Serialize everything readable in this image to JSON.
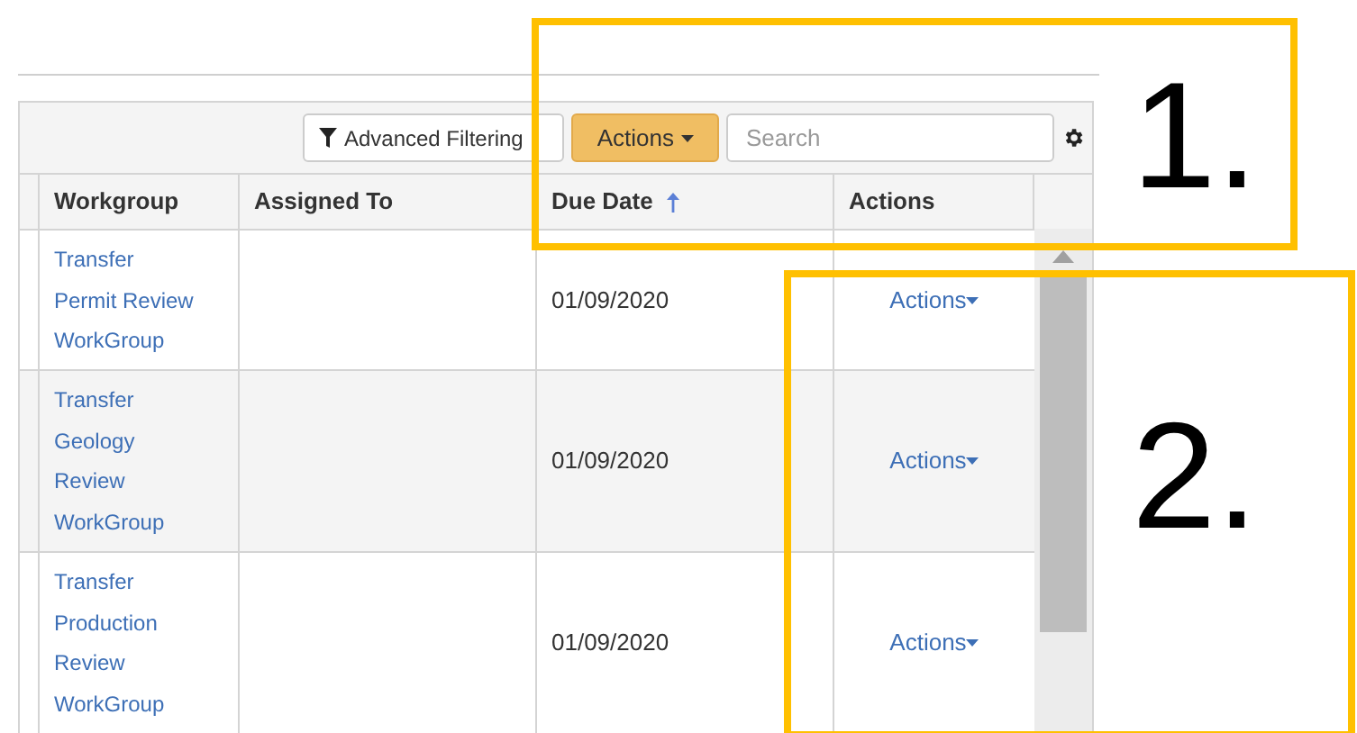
{
  "toolbar": {
    "filter_button": "Advanced Filtering",
    "actions_button": "Actions",
    "search": {
      "placeholder": "Search"
    }
  },
  "table": {
    "columns": [
      {
        "label": "Workgroup",
        "sorted": false
      },
      {
        "label": "Assigned To",
        "sorted": false
      },
      {
        "label": "Due Date",
        "sorted": true
      },
      {
        "label": "Actions",
        "sorted": false
      }
    ],
    "rows": [
      {
        "workgroup": "Transfer Permit Review WorkGroup",
        "due_date": "01/09/2020",
        "action": "Actions"
      },
      {
        "workgroup": "Transfer Geology Review WorkGroup",
        "due_date": "01/09/2020",
        "action": "Actions"
      },
      {
        "workgroup": "Transfer Production Review WorkGroup",
        "due_date": "01/09/2020",
        "action": "Actions"
      }
    ]
  },
  "annotations": [
    "1.",
    "2."
  ]
}
